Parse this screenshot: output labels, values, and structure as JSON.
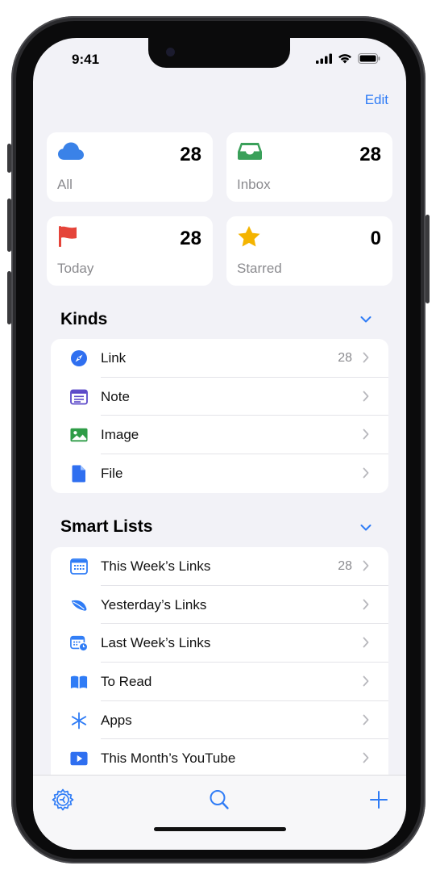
{
  "status": {
    "time": "9:41"
  },
  "header": {
    "edit_label": "Edit"
  },
  "cards": [
    {
      "label": "All",
      "count": "28",
      "icon": "cloud-icon"
    },
    {
      "label": "Inbox",
      "count": "28",
      "icon": "inbox-tray-icon"
    },
    {
      "label": "Today",
      "count": "28",
      "icon": "flag-icon"
    },
    {
      "label": "Starred",
      "count": "0",
      "icon": "star-icon"
    }
  ],
  "kinds": {
    "title": "Kinds",
    "items": [
      {
        "label": "Link",
        "count": "28",
        "icon": "compass-icon"
      },
      {
        "label": "Note",
        "count": "",
        "icon": "note-icon"
      },
      {
        "label": "Image",
        "count": "",
        "icon": "photo-icon"
      },
      {
        "label": "File",
        "count": "",
        "icon": "document-icon"
      }
    ]
  },
  "smart_lists": {
    "title": "Smart Lists",
    "items": [
      {
        "label": "This Week’s Links",
        "count": "28",
        "icon": "calendar-icon"
      },
      {
        "label": "Yesterday’s Links",
        "count": "",
        "icon": "leaf-icon"
      },
      {
        "label": "Last Week’s Links",
        "count": "",
        "icon": "calendar-clock-icon"
      },
      {
        "label": "To Read",
        "count": "",
        "icon": "book-icon"
      },
      {
        "label": "Apps",
        "count": "",
        "icon": "asterisk-icon"
      },
      {
        "label": "This Month’s YouTube",
        "count": "",
        "icon": "play-rectangle-icon"
      }
    ]
  },
  "tabbar": {
    "items": [
      "settings-gear-icon",
      "search-icon",
      "plus-icon"
    ]
  },
  "colors": {
    "accent": "#2f7cf6",
    "background": "#f2f2f7",
    "flag": "#e5443a",
    "star": "#f4b400",
    "inbox": "#3aa05a"
  }
}
